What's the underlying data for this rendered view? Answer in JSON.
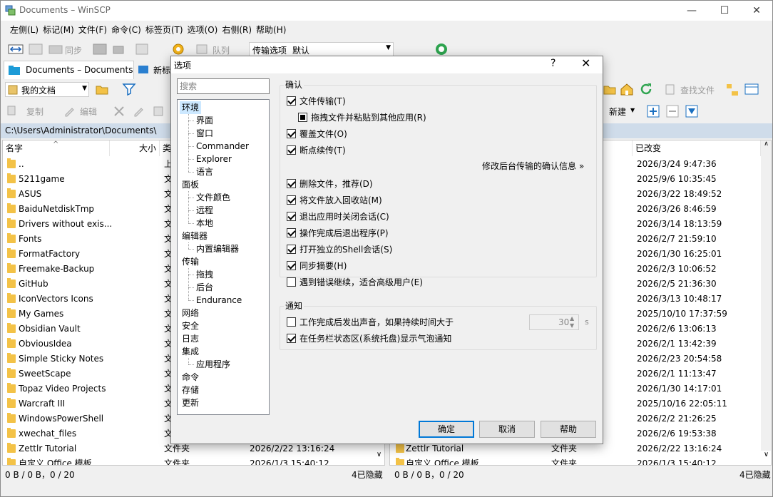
{
  "window": {
    "title": "Documents – WinSCP",
    "minimize": "—",
    "maximize": "☐",
    "close": "✕"
  },
  "menu": [
    "左侧(L)",
    "标记(M)",
    "文件(F)",
    "命令(C)",
    "标签页(T)",
    "选项(O)",
    "右侧(R)",
    "帮助(H)"
  ],
  "toolbar": {
    "sync_label": "同步",
    "queue_label": "队列",
    "transfer_label": "传输选项",
    "transfer_value": "默认"
  },
  "tabs": {
    "session_tab": "Documents – Documents",
    "new_tab": "新标"
  },
  "left_panel": {
    "location": "我的文档",
    "copy_label": "复制",
    "edit_label": "编辑",
    "path": "C:\\Users\\Administrator\\Documents\\",
    "columns": {
      "name": "名字",
      "size": "大小",
      "type": "类"
    },
    "rows": [
      {
        "name": "..",
        "type": "上"
      },
      {
        "name": "5211game",
        "type": "文"
      },
      {
        "name": "ASUS",
        "type": "文"
      },
      {
        "name": "BaiduNetdiskTmp",
        "type": "文"
      },
      {
        "name": "Drivers without exis...",
        "type": "文"
      },
      {
        "name": "Fonts",
        "type": "文"
      },
      {
        "name": "FormatFactory",
        "type": "文"
      },
      {
        "name": "Freemake-Backup",
        "type": "文"
      },
      {
        "name": "GitHub",
        "type": "文"
      },
      {
        "name": "IconVectors Icons",
        "type": "文"
      },
      {
        "name": "My Games",
        "type": "文"
      },
      {
        "name": "Obsidian Vault",
        "type": "文"
      },
      {
        "name": "ObviousIdea",
        "type": "文"
      },
      {
        "name": "Simple Sticky Notes",
        "type": "文"
      },
      {
        "name": "SweetScape",
        "type": "文"
      },
      {
        "name": "Topaz Video Projects",
        "type": "文"
      },
      {
        "name": "Warcraft III",
        "type": "文"
      },
      {
        "name": "WindowsPowerShell",
        "type": "文"
      },
      {
        "name": "xwechat_files",
        "type": "文"
      }
    ],
    "bottom_rows": [
      {
        "name": "Zettlr Tutorial",
        "type": "文件夹",
        "date": "2026/2/22 13:16:24"
      },
      {
        "name": "自定义 Office 模板",
        "type": "文件夹",
        "date": "2026/1/3 15:40:12"
      }
    ],
    "status_left": "0 B / 0 B，0 / 20",
    "status_right": "4已隐藏"
  },
  "right_panel": {
    "find_label": "查找文件",
    "new_label": "新建",
    "column_changed": "已改变",
    "dates": [
      "2026/3/24 9:47:36",
      "2025/9/6 10:35:45",
      "2026/3/22 18:49:52",
      "2026/3/26 8:46:59",
      "2026/3/14 18:13:59",
      "2026/2/7 21:59:10",
      "2026/1/30 16:25:01",
      "2026/2/3 10:06:52",
      "2026/2/5 21:36:30",
      "2026/3/13 10:48:17",
      "2025/10/10 17:37:59",
      "2026/2/6 13:06:13",
      "2026/2/1 13:42:39",
      "2026/2/23 20:54:58",
      "2026/2/1 11:13:47",
      "2026/1/30 14:17:01",
      "2025/10/16 22:05:11",
      "2026/2/2 21:26:25",
      "2026/2/6 19:53:38"
    ],
    "bottom_rows": [
      {
        "name": "Zettlr Tutorial",
        "type": "文件夹",
        "date": "2026/2/22 13:16:24"
      },
      {
        "name": "自定义 Office 模板",
        "type": "文件夹",
        "date": "2026/1/3 15:40:12"
      }
    ],
    "status_left": "0 B / 0 B，0 / 20",
    "status_right": "4已隐藏"
  },
  "dialog": {
    "title": "选项",
    "help": "?",
    "close": "✕",
    "search_placeholder": "搜索",
    "tree": [
      {
        "label": "环境",
        "level": 1,
        "selected": true
      },
      {
        "label": "界面",
        "level": 2
      },
      {
        "label": "窗口",
        "level": 2
      },
      {
        "label": "Commander",
        "level": 2
      },
      {
        "label": "Explorer",
        "level": 2
      },
      {
        "label": "语言",
        "level": 2
      },
      {
        "label": "面板",
        "level": 1
      },
      {
        "label": "文件颜色",
        "level": 2
      },
      {
        "label": "远程",
        "level": 2
      },
      {
        "label": "本地",
        "level": 2
      },
      {
        "label": "编辑器",
        "level": 1
      },
      {
        "label": "内置编辑器",
        "level": 2
      },
      {
        "label": "传输",
        "level": 1
      },
      {
        "label": "拖拽",
        "level": 2
      },
      {
        "label": "后台",
        "level": 2
      },
      {
        "label": "Endurance",
        "level": 2
      },
      {
        "label": "网络",
        "level": 1
      },
      {
        "label": "安全",
        "level": 1
      },
      {
        "label": "日志",
        "level": 1
      },
      {
        "label": "集成",
        "level": 1
      },
      {
        "label": "应用程序",
        "level": 2
      },
      {
        "label": "命令",
        "level": 1
      },
      {
        "label": "存储",
        "level": 1
      },
      {
        "label": "更新",
        "level": 1
      }
    ],
    "confirm_group": "确认",
    "confirm_items_a": [
      {
        "label": "文件传输(T)",
        "checked": true,
        "indent": 0
      },
      {
        "label": "拖拽文件并粘贴到其他应用(R)",
        "checked": "partial",
        "indent": 1
      },
      {
        "label": "覆盖文件(O)",
        "checked": true,
        "indent": 0
      },
      {
        "label": "断点续传(T)",
        "checked": true,
        "indent": 0
      }
    ],
    "background_link": "修改后台传输的确认信息 »",
    "confirm_items_b": [
      {
        "label": "删除文件，推荐(D)",
        "checked": true
      },
      {
        "label": "将文件放入回收站(M)",
        "checked": true
      },
      {
        "label": "退出应用时关闭会话(C)",
        "checked": true
      },
      {
        "label": "操作完成后退出程序(P)",
        "checked": true
      },
      {
        "label": "打开独立的Shell会话(S)",
        "checked": true
      },
      {
        "label": "同步摘要(H)",
        "checked": true
      },
      {
        "label": "遇到错误继续，适合高级用户(E)",
        "checked": false
      }
    ],
    "notify_group": "通知",
    "notify_items": [
      {
        "label": "工作完成后发出声音，如果持续时间大于",
        "checked": false
      },
      {
        "label": "在任务栏状态区(系统托盘)显示气泡通知",
        "checked": true
      }
    ],
    "seconds_value": "30",
    "seconds_unit": "s",
    "ok": "确定",
    "cancel": "取消",
    "help_button": "帮助"
  }
}
